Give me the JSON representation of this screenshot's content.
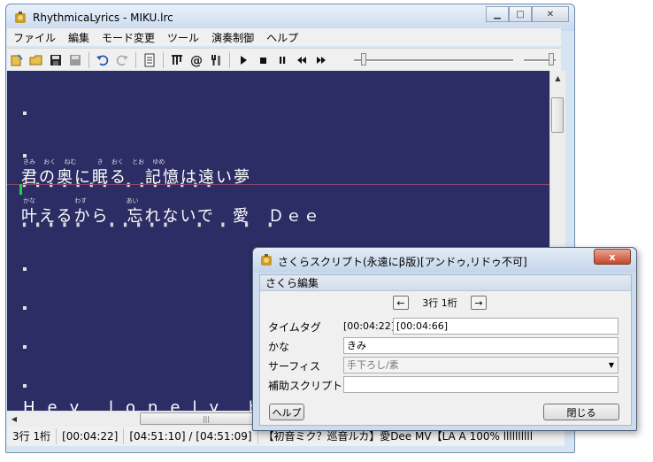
{
  "main_window": {
    "title": "RhythmicaLyrics - MIKU.lrc",
    "menu": [
      "ファイル",
      "編集",
      "モード変更",
      "ツール",
      "演奏制御",
      "ヘルプ"
    ]
  },
  "editor": {
    "line1": {
      "ruby": "きみ　 おく　 ねむ　　　 き　 おく　 とお　 ゆめ",
      "text": "君の奥に眠る　記憶は遠い夢"
    },
    "line2": {
      "ruby": "かな　　　　　　 わす　　　　　　 あい",
      "text": "叶えるから　忘れないで　愛　Ｄｅｅ"
    },
    "line3": {
      "text": "Hey lonely b"
    }
  },
  "statusbar": {
    "position": "3行 1桁",
    "current_time": "[00:04:22]",
    "total_time": "[04:51:10] / [04:51:09]",
    "song": "【初音ミク？巡音ルカ】愛Dee MV【LA A 100% llllllllll"
  },
  "dialog": {
    "title": "さくらスクリプト(永遠にβ版)[アンドゥ,リドゥ不可]",
    "close_glyph": "x",
    "section": "さくら編集",
    "nav_prev": "←",
    "nav_text": "3行 1桁",
    "nav_next": "→",
    "timetag_label": "タイムタグ",
    "timetag_start": "[00:04:22]",
    "timetag_end": "[00:04:66]",
    "kana_label": "かな",
    "kana_value": "きみ",
    "surface_label": "サーフィス",
    "surface_value": "手下ろし/素",
    "assist_label": "補助スクリプト",
    "assist_value": "",
    "help_button": "ヘルプ",
    "close_button": "閉じる"
  }
}
